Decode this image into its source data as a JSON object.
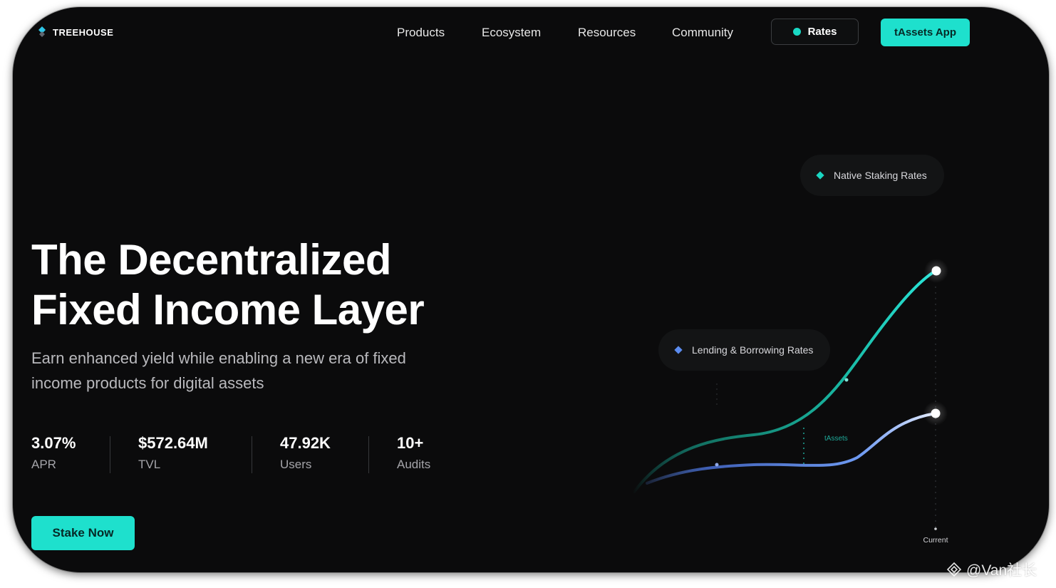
{
  "brand": {
    "name": "TREEHOUSE",
    "accent": "#1ee0cd",
    "background": "#0b0b0c"
  },
  "nav": {
    "links": [
      "Products",
      "Ecosystem",
      "Resources",
      "Community"
    ],
    "rates_button": "Rates",
    "app_button": "tAssets App"
  },
  "hero": {
    "title_line1": "The Decentralized",
    "title_line2": "Fixed Income Layer",
    "subtitle_line1": "Earn enhanced yield while enabling a new era of fixed",
    "subtitle_line2": "income products for digital assets",
    "cta": "Stake Now"
  },
  "stats": [
    {
      "value": "3.07%",
      "label": "APR"
    },
    {
      "value": "$572.64M",
      "label": "TVL"
    },
    {
      "value": "47.92K",
      "label": "Users"
    },
    {
      "value": "10+",
      "label": "Audits"
    }
  ],
  "chart": {
    "series": [
      {
        "name": "Native Staking Rates",
        "color": "#1ad6c2"
      },
      {
        "name": "Lending & Borrowing Rates",
        "color": "#5b8cf0"
      }
    ],
    "gap_label": "tAssets",
    "x_label": "Current"
  },
  "watermark": "@Van社长"
}
